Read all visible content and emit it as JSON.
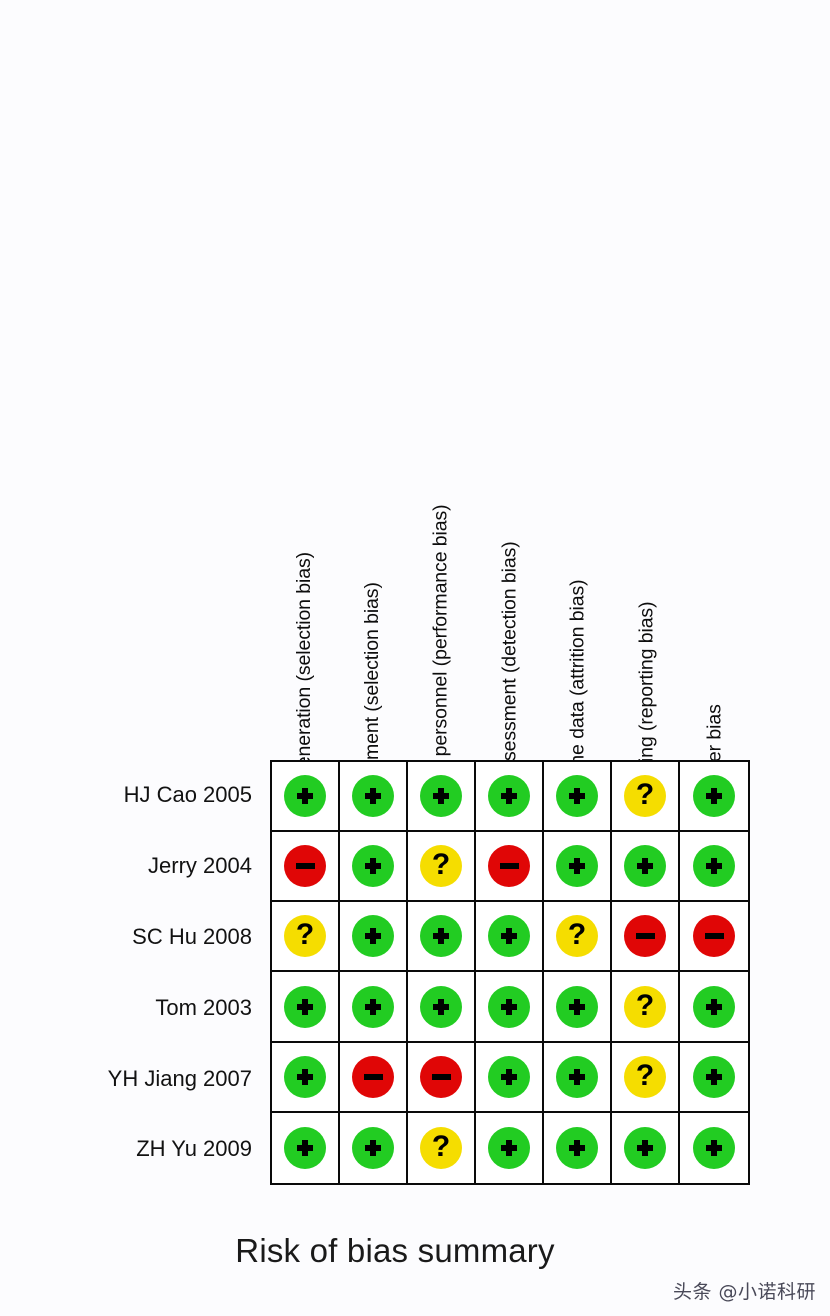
{
  "caption": "Risk of bias summary",
  "watermark": "头条 @小诺科研",
  "colors": {
    "low_risk": "#22cc22",
    "high_risk": "#e00606",
    "unclear_risk": "#f5dd00",
    "grid_line": "#0a0a0a",
    "background": "#fcfcfe"
  },
  "symbols": {
    "plus": "+",
    "minus": "−",
    "unclear": "?"
  },
  "chart_data": {
    "type": "heatmap",
    "title": "Risk of bias summary",
    "xlabel": "",
    "ylabel": "",
    "legend_position": "none",
    "grid": true,
    "domains": [
      "Random sequence generation (selection bias)",
      "Allocation concealment (selection bias)",
      "Blinding of participants and personnel (performance bias)",
      "Blinding of outcome assessment (detection bias)",
      "Incomplete outcome data (attrition bias)",
      "Selective reporting (reporting bias)",
      "Other bias"
    ],
    "studies": [
      "HJ Cao 2005",
      "Jerry 2004",
      "SC Hu 2008",
      "Tom 2003",
      "YH Jiang 2007",
      "ZH Yu 2009"
    ],
    "judgement_levels": [
      "plus",
      "minus",
      "unclear"
    ],
    "judgement_meanings": {
      "plus": "Low risk of bias",
      "minus": "High risk of bias",
      "unclear": "Unclear risk of bias"
    },
    "values": [
      [
        "plus",
        "plus",
        "plus",
        "plus",
        "plus",
        "unclear",
        "plus"
      ],
      [
        "minus",
        "plus",
        "unclear",
        "minus",
        "plus",
        "plus",
        "plus"
      ],
      [
        "unclear",
        "plus",
        "plus",
        "plus",
        "unclear",
        "minus",
        "minus"
      ],
      [
        "plus",
        "plus",
        "plus",
        "plus",
        "plus",
        "unclear",
        "plus"
      ],
      [
        "plus",
        "minus",
        "minus",
        "plus",
        "plus",
        "unclear",
        "plus"
      ],
      [
        "plus",
        "plus",
        "unclear",
        "plus",
        "plus",
        "plus",
        "plus"
      ]
    ]
  }
}
